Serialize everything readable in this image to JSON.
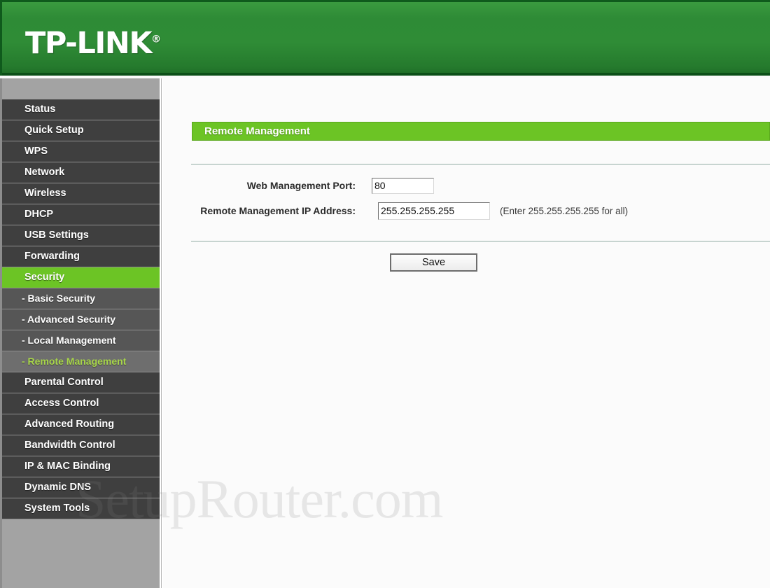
{
  "header": {
    "brand": "TP-LINK",
    "registered_mark": "®"
  },
  "sidebar": {
    "items": [
      {
        "label": "Status",
        "type": "main",
        "state": "normal"
      },
      {
        "label": "Quick Setup",
        "type": "main",
        "state": "normal"
      },
      {
        "label": "WPS",
        "type": "main",
        "state": "normal"
      },
      {
        "label": "Network",
        "type": "main",
        "state": "normal"
      },
      {
        "label": "Wireless",
        "type": "main",
        "state": "normal"
      },
      {
        "label": "DHCP",
        "type": "main",
        "state": "normal"
      },
      {
        "label": "USB Settings",
        "type": "main",
        "state": "normal"
      },
      {
        "label": "Forwarding",
        "type": "main",
        "state": "normal"
      },
      {
        "label": "Security",
        "type": "main",
        "state": "active-parent"
      },
      {
        "label": "- Basic Security",
        "type": "sub",
        "state": "normal"
      },
      {
        "label": "- Advanced Security",
        "type": "sub",
        "state": "normal"
      },
      {
        "label": "- Local Management",
        "type": "sub",
        "state": "normal"
      },
      {
        "label": "- Remote Management",
        "type": "sub",
        "state": "active-sub"
      },
      {
        "label": "Parental Control",
        "type": "main",
        "state": "normal"
      },
      {
        "label": "Access Control",
        "type": "main",
        "state": "normal"
      },
      {
        "label": "Advanced Routing",
        "type": "main",
        "state": "normal"
      },
      {
        "label": "Bandwidth Control",
        "type": "main",
        "state": "normal"
      },
      {
        "label": "IP & MAC Binding",
        "type": "main",
        "state": "normal"
      },
      {
        "label": "Dynamic DNS",
        "type": "main",
        "state": "normal"
      },
      {
        "label": "System Tools",
        "type": "main",
        "state": "normal"
      }
    ]
  },
  "main": {
    "panel_title": "Remote Management",
    "fields": {
      "web_port": {
        "label": "Web Management Port:",
        "value": "80"
      },
      "remote_ip": {
        "label": "Remote Management IP Address:",
        "value": "255.255.255.255",
        "hint": "(Enter 255.255.255.255 for all)"
      }
    },
    "save_label": "Save"
  },
  "watermark": {
    "text": "SetupRouter.com"
  },
  "colors": {
    "brand_green": "#2e8b36",
    "accent_green": "#6cc425",
    "active_sub_text": "#a8d64a",
    "menu_dark": "#3f3f3f",
    "menu_sub": "#565656",
    "sidebar_bg": "#a3a3a3"
  }
}
